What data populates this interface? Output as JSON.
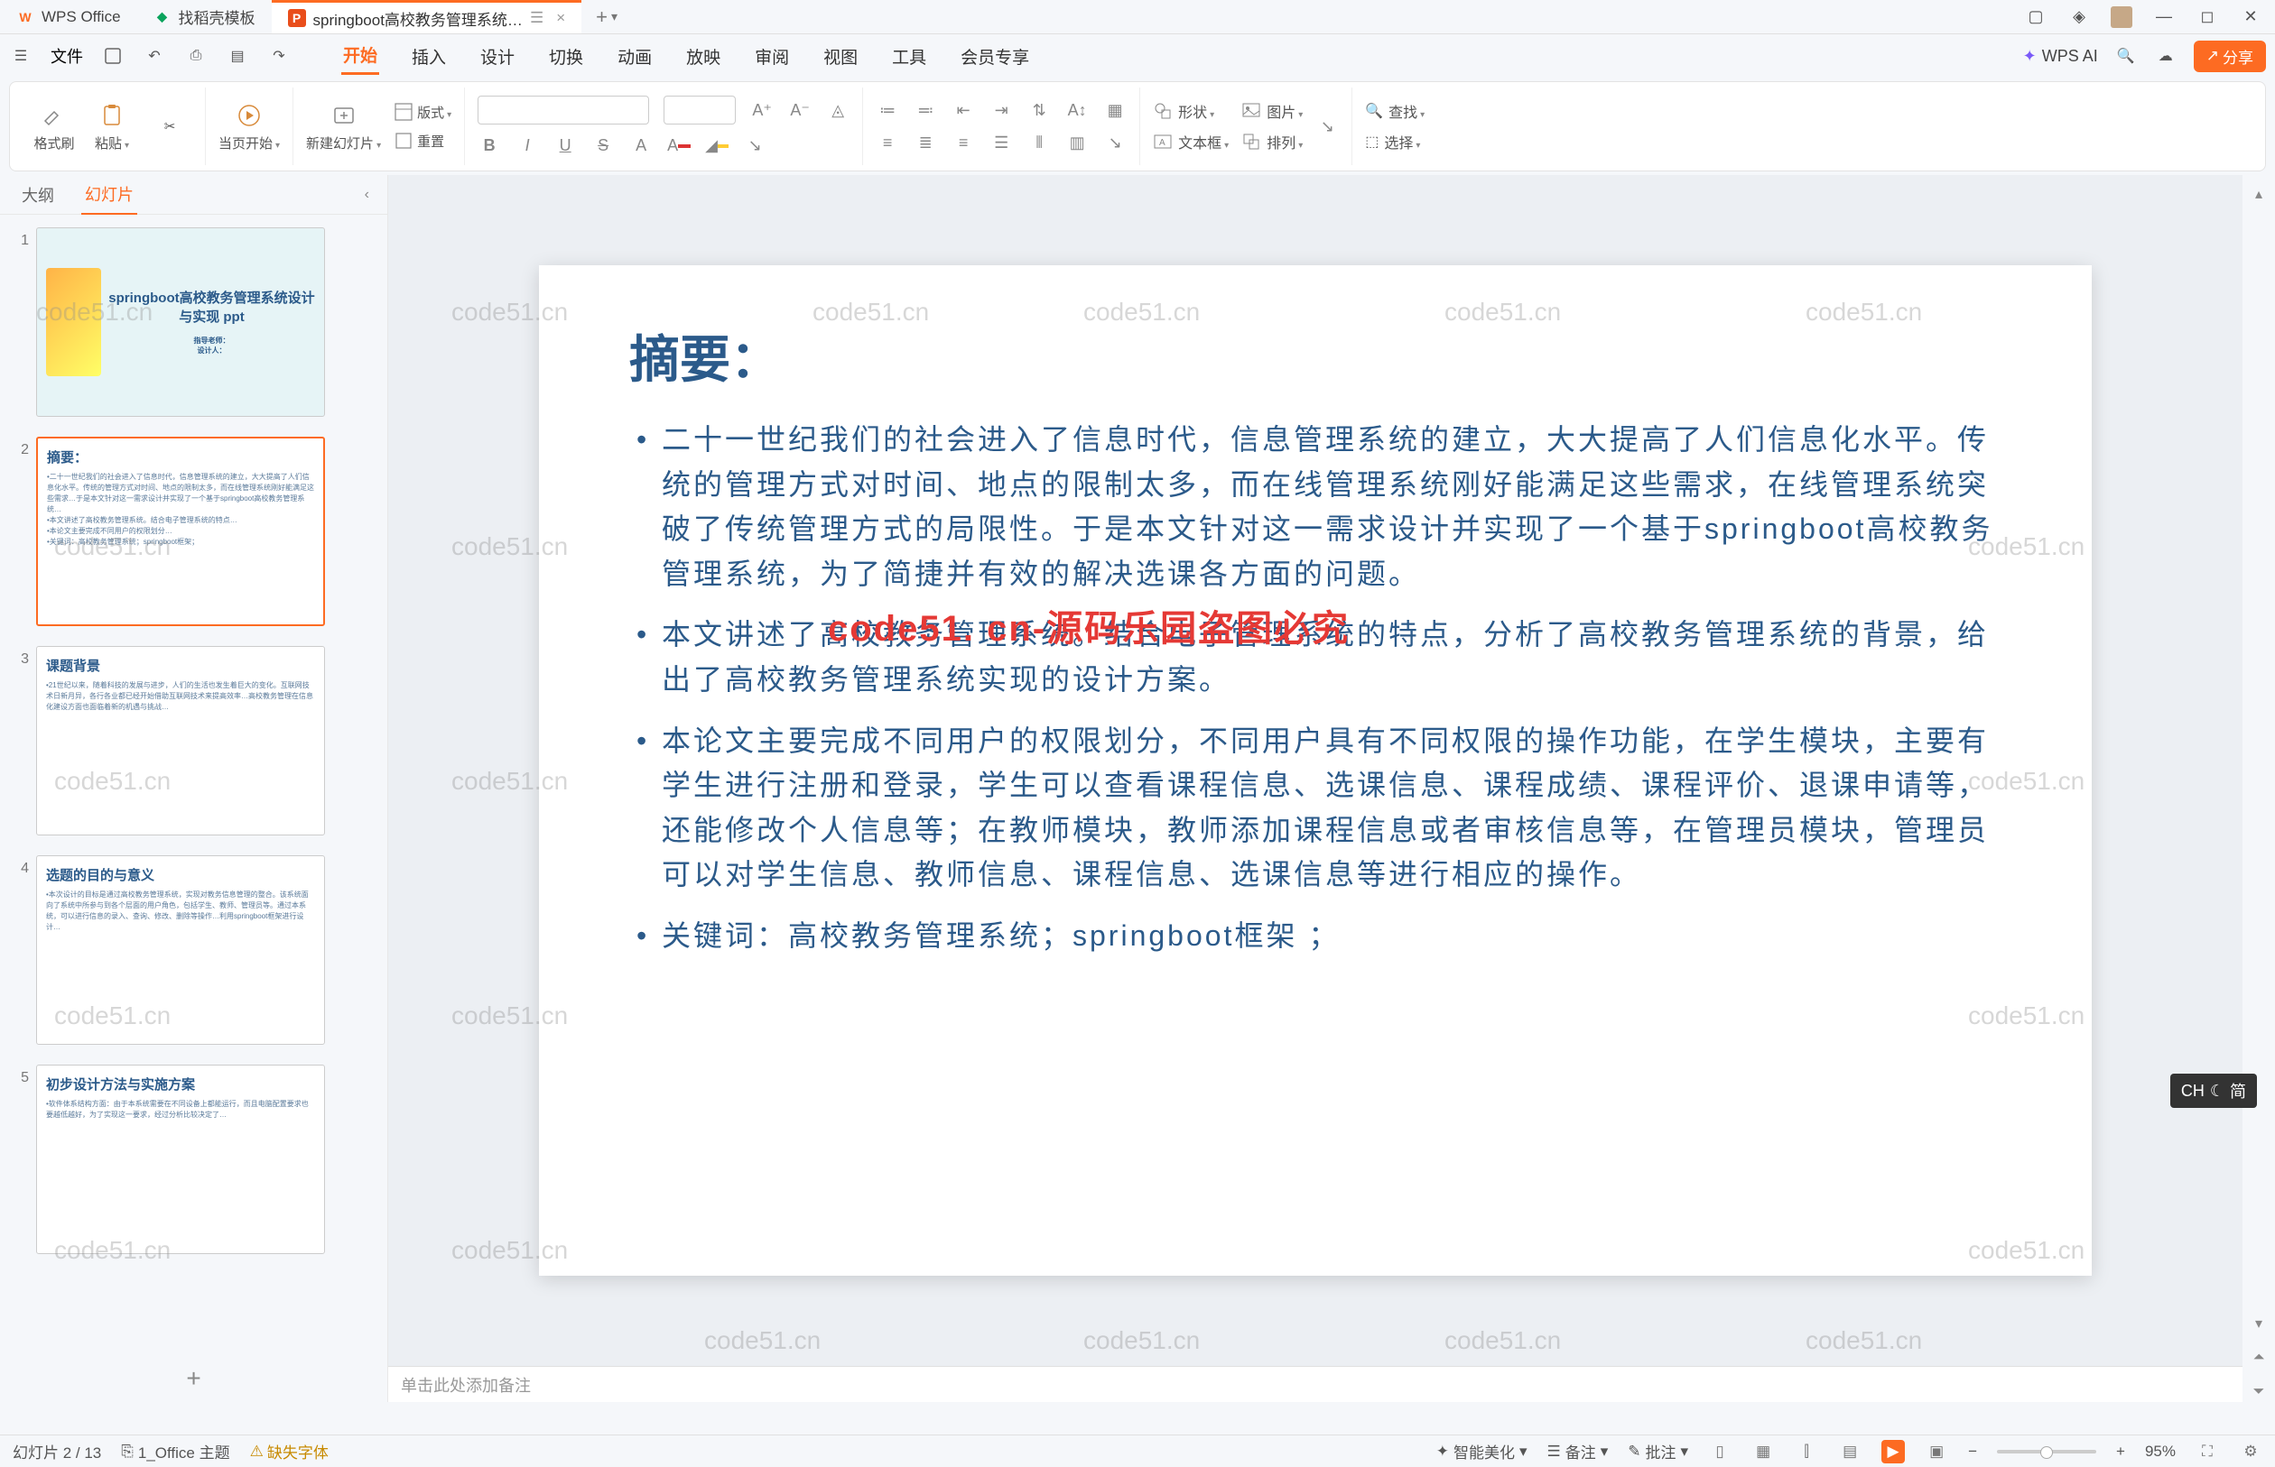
{
  "titlebar": {
    "tab_wps": "WPS Office",
    "tab_template": "找稻壳模板",
    "tab_active": "springboot高校教务管理系统…",
    "close_x": "×",
    "plus": "+",
    "drop": "▾"
  },
  "menubar": {
    "file": "文件",
    "items": [
      "开始",
      "插入",
      "设计",
      "切换",
      "动画",
      "放映",
      "审阅",
      "视图",
      "工具",
      "会员专享"
    ],
    "wpsai": "WPS AI",
    "share": "分享"
  },
  "ribbon": {
    "fmtpaint": "格式刷",
    "paste": "粘贴",
    "curpage": "当页开始",
    "newslide": "新建幻灯片",
    "layout": "版式",
    "reset": "重置",
    "shape": "形状",
    "textbox": "文本框",
    "picture": "图片",
    "arrange": "排列",
    "find": "查找",
    "select": "选择"
  },
  "leftpanel": {
    "tab_outline": "大纲",
    "tab_slides": "幻灯片",
    "collapse": "‹"
  },
  "thumbs": [
    {
      "n": "1",
      "title": "springboot高校教务管理系统设计与实现 ppt",
      "sub1": "指导老师：",
      "sub2": "设计人："
    },
    {
      "n": "2",
      "title": "摘要："
    },
    {
      "n": "3",
      "title": "课题背景"
    },
    {
      "n": "4",
      "title": "选题的目的与意义"
    },
    {
      "n": "5",
      "title": "初步设计方法与实施方案"
    }
  ],
  "slide": {
    "title": "摘要：",
    "b1": "二十一世纪我们的社会进入了信息时代，信息管理系统的建立，大大提高了人们信息化水平。传统的管理方式对时间、地点的限制太多，而在线管理系统刚好能满足这些需求，在线管理系统突破了传统管理方式的局限性。于是本文针对这一需求设计并实现了一个基于springboot高校教务管理系统，为了简捷并有效的解决选课各方面的问题。",
    "b2": "本文讲述了高校教务管理系统。结合电子管理系统的特点，分析了高校教务管理系统的背景，给出了高校教务管理系统实现的设计方案。",
    "b3": "本论文主要完成不同用户的权限划分，不同用户具有不同权限的操作功能，在学生模块，主要有学生进行注册和登录，学生可以查看课程信息、选课信息、课程成绩、课程评价、退课申请等，还能修改个人信息等；在教师模块，教师添加课程信息或者审核信息等，在管理员模块，管理员可以对学生信息、教师信息、课程信息、选课信息等进行相应的操作。",
    "b4": "关键词：高校教务管理系统；springboot框架 ；",
    "stamp": "code51. cn-源码乐园盗图必究",
    "wm": "code51.cn"
  },
  "notes": {
    "placeholder": "单击此处添加备注"
  },
  "status": {
    "page": "幻灯片 2 / 13",
    "theme": "1_Office 主题",
    "missing": "缺失字体",
    "beautify": "智能美化",
    "notes": "备注",
    "review": "批注",
    "zoom": "95%",
    "minus": "−",
    "plus": "+"
  },
  "ime": {
    "lang": "CH",
    "mode": "简"
  }
}
